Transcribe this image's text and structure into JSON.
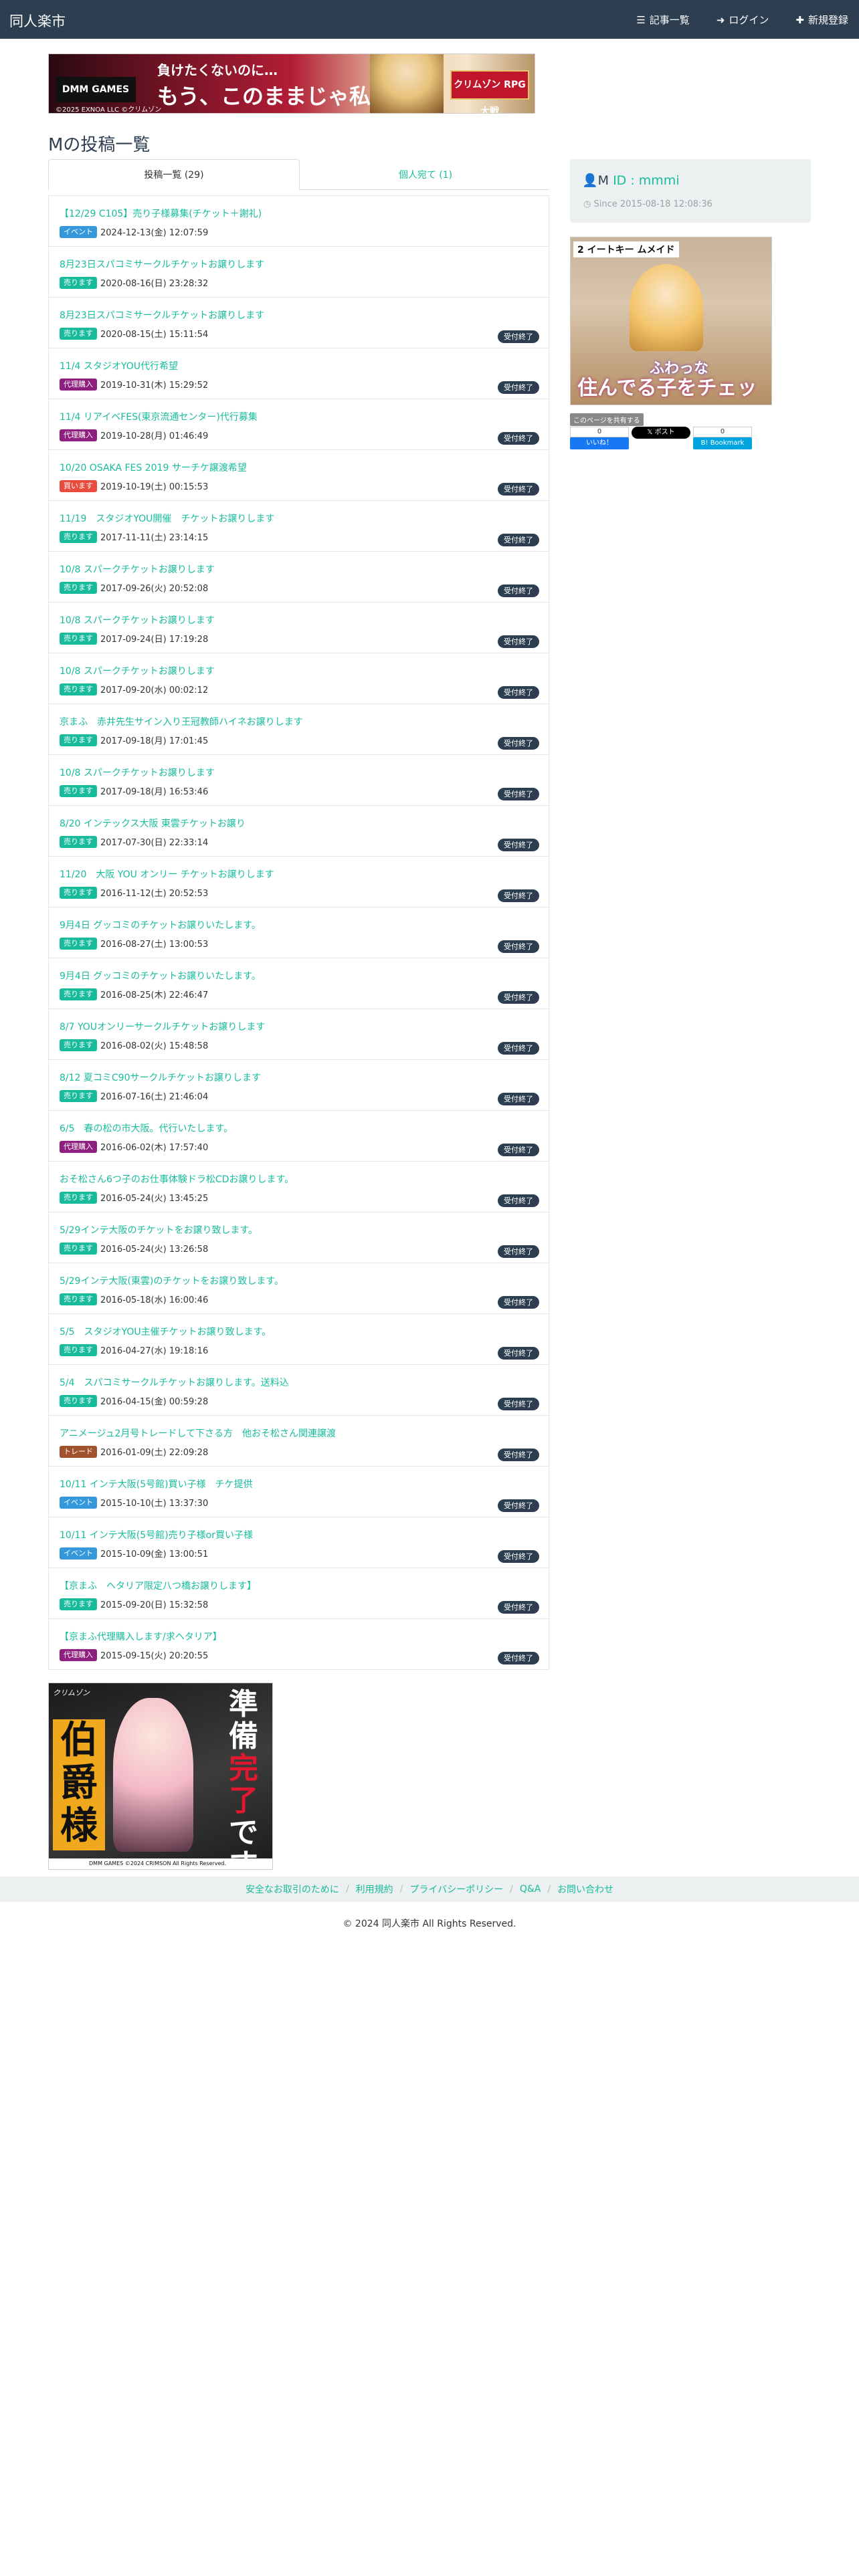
{
  "colors": {
    "navbar": "#2c3e50",
    "accent": "#18bc9c",
    "tag_event": "#3498db",
    "tag_sell": "#18bc9c",
    "tag_proxy": "#8e1f7e",
    "tag_buy": "#e74c3c",
    "tag_trade": "#a0522d",
    "done_badge": "#2c3e50"
  },
  "nav": {
    "brand": "同人楽市",
    "articles_icon": "list-icon",
    "articles": "記事一覧",
    "login_icon": "login-icon",
    "login": "ログイン",
    "register_icon": "plus-icon",
    "register": "新規登録"
  },
  "banner_top": {
    "logo": "DMM GAMES",
    "copy": "©2025 EXNOA LLC ©クリムゾン",
    "line1": "負けたくないのに…",
    "line2": "もう、このままじゃ私…！",
    "badge": "クリムゾン RPG 大戦"
  },
  "page_title": "Mの投稿一覧",
  "tabs": {
    "posts": "投稿一覧 (29)",
    "personal": "個人宛て (1)"
  },
  "posts": [
    {
      "title": "【12/29 C105】売り子様募集(チケット＋謝礼)",
      "tag": "イベント",
      "tag_color": "#3498db",
      "date": "2024-12-13(金) 12:07:59",
      "status": ""
    },
    {
      "title": "8月23日スパコミサークルチケットお譲りします",
      "tag": "売ります",
      "tag_color": "#18bc9c",
      "date": "2020-08-16(日) 23:28:32",
      "status": ""
    },
    {
      "title": "8月23日スパコミサークルチケットお譲りします",
      "tag": "売ります",
      "tag_color": "#18bc9c",
      "date": "2020-08-15(土) 15:11:54",
      "status": "受付終了"
    },
    {
      "title": "11/4 スタジオYOU代行希望",
      "tag": "代理購入",
      "tag_color": "#8e1f7e",
      "date": "2019-10-31(木) 15:29:52",
      "status": "受付終了"
    },
    {
      "title": "11/4 リアイベFES(東京流通センター)代行募集",
      "tag": "代理購入",
      "tag_color": "#8e1f7e",
      "date": "2019-10-28(月) 01:46:49",
      "status": "受付終了"
    },
    {
      "title": "10/20 OSAKA FES 2019 サーチケ譲渡希望",
      "tag": "買います",
      "tag_color": "#e74c3c",
      "date": "2019-10-19(土) 00:15:53",
      "status": "受付終了"
    },
    {
      "title": "11/19　スタジオYOU開催　チケットお譲りします",
      "tag": "売ります",
      "tag_color": "#18bc9c",
      "date": "2017-11-11(土) 23:14:15",
      "status": "受付終了"
    },
    {
      "title": "10/8 スパークチケットお譲りします",
      "tag": "売ります",
      "tag_color": "#18bc9c",
      "date": "2017-09-26(火) 20:52:08",
      "status": "受付終了"
    },
    {
      "title": "10/8 スパークチケットお譲りします",
      "tag": "売ります",
      "tag_color": "#18bc9c",
      "date": "2017-09-24(日) 17:19:28",
      "status": "受付終了"
    },
    {
      "title": "10/8 スパークチケットお譲りします",
      "tag": "売ります",
      "tag_color": "#18bc9c",
      "date": "2017-09-20(水) 00:02:12",
      "status": "受付終了"
    },
    {
      "title": "京まふ　赤井先生サイン入り王冠教師ハイネお譲りします",
      "tag": "売ります",
      "tag_color": "#18bc9c",
      "date": "2017-09-18(月) 17:01:45",
      "status": "受付終了"
    },
    {
      "title": "10/8 スパークチケットお譲りします",
      "tag": "売ります",
      "tag_color": "#18bc9c",
      "date": "2017-09-18(月) 16:53:46",
      "status": "受付終了"
    },
    {
      "title": "8/20 インテックス大阪 東雲チケットお譲り",
      "tag": "売ります",
      "tag_color": "#18bc9c",
      "date": "2017-07-30(日) 22:33:14",
      "status": "受付終了"
    },
    {
      "title": "11/20　大阪 YOU オンリー チケットお譲りします",
      "tag": "売ります",
      "tag_color": "#18bc9c",
      "date": "2016-11-12(土) 20:52:53",
      "status": "受付終了"
    },
    {
      "title": "9月4日 グッコミのチケットお譲りいたします。",
      "tag": "売ります",
      "tag_color": "#18bc9c",
      "date": "2016-08-27(土) 13:00:53",
      "status": "受付終了"
    },
    {
      "title": "9月4日 グッコミのチケットお譲りいたします。",
      "tag": "売ります",
      "tag_color": "#18bc9c",
      "date": "2016-08-25(木) 22:46:47",
      "status": "受付終了"
    },
    {
      "title": "8/7 YOUオンリーサークルチケットお譲りします",
      "tag": "売ります",
      "tag_color": "#18bc9c",
      "date": "2016-08-02(火) 15:48:58",
      "status": "受付終了"
    },
    {
      "title": "8/12 夏コミC90サークルチケットお譲りします",
      "tag": "売ります",
      "tag_color": "#18bc9c",
      "date": "2016-07-16(土) 21:46:04",
      "status": "受付終了"
    },
    {
      "title": "6/5　春の松の市大阪。代行いたします。",
      "tag": "代理購入",
      "tag_color": "#8e1f7e",
      "date": "2016-06-02(木) 17:57:40",
      "status": "受付終了"
    },
    {
      "title": "おそ松さん6つ子のお仕事体験ドラ松CDお譲りします。",
      "tag": "売ります",
      "tag_color": "#18bc9c",
      "date": "2016-05-24(火) 13:45:25",
      "status": "受付終了"
    },
    {
      "title": "5/29インテ大阪のチケットをお譲り致します。",
      "tag": "売ります",
      "tag_color": "#18bc9c",
      "date": "2016-05-24(火) 13:26:58",
      "status": "受付終了"
    },
    {
      "title": "5/29インテ大阪(東雲)のチケットをお譲り致します。",
      "tag": "売ります",
      "tag_color": "#18bc9c",
      "date": "2016-05-18(水) 16:00:46",
      "status": "受付終了"
    },
    {
      "title": "5/5　スタジオYOU主催チケットお譲り致します。",
      "tag": "売ります",
      "tag_color": "#18bc9c",
      "date": "2016-04-27(水) 19:18:16",
      "status": "受付終了"
    },
    {
      "title": "5/4　スパコミサークルチケットお譲りします。送料込",
      "tag": "売ります",
      "tag_color": "#18bc9c",
      "date": "2016-04-15(金) 00:59:28",
      "status": "受付終了"
    },
    {
      "title": "アニメージュ2月号トレードして下さる方　他おそ松さん関連譲渡",
      "tag": "トレード",
      "tag_color": "#a0522d",
      "date": "2016-01-09(土) 22:09:28",
      "status": "受付終了"
    },
    {
      "title": "10/11 インテ大阪(5号館)買い子様　チケ提供",
      "tag": "イベント",
      "tag_color": "#3498db",
      "date": "2015-10-10(土) 13:37:30",
      "status": "受付終了"
    },
    {
      "title": "10/11 インテ大阪(5号館)売り子様or買い子様",
      "tag": "イベント",
      "tag_color": "#3498db",
      "date": "2015-10-09(金) 13:00:51",
      "status": "受付終了"
    },
    {
      "title": "【京まふ　ヘタリア限定八つ橋お譲りします】",
      "tag": "売ります",
      "tag_color": "#18bc9c",
      "date": "2015-09-20(日) 15:32:58",
      "status": "受付終了"
    },
    {
      "title": "【京まふ代理購入します/求ヘタリア】",
      "tag": "代理購入",
      "tag_color": "#8e1f7e",
      "date": "2015-09-15(火) 20:20:55",
      "status": "受付終了"
    }
  ],
  "profile": {
    "user_icon": "user-icon",
    "name": "M",
    "id": "ID : mmmi",
    "clock_icon": "clock-icon",
    "since": "Since 2015-08-18 12:08:36"
  },
  "side_ad": {
    "header": "2 イートキー ムメイド",
    "cap1": "ふわっな",
    "cap2": "住んでる子をチェック！"
  },
  "share": {
    "label": "このページを共有する",
    "fb_count": "0",
    "fb": "いいね！",
    "x": "ポスト",
    "hb_count": "0",
    "hb": "Bookmark"
  },
  "bottom_ad": {
    "crest": "クリムゾン",
    "k1": "伯爵様",
    "k2a": "準備",
    "k2b": "完了",
    "k2c": "です",
    "foot": "DMM GAMES ©2024 CRIMSON  All Rights Reserved."
  },
  "footer": {
    "links": [
      "安全なお取引のために",
      "利用規約",
      "プライバシーポリシー",
      "Q&A",
      "お問い合わせ"
    ],
    "copyright": "© 2024 同人楽市 All Rights Reserved."
  }
}
